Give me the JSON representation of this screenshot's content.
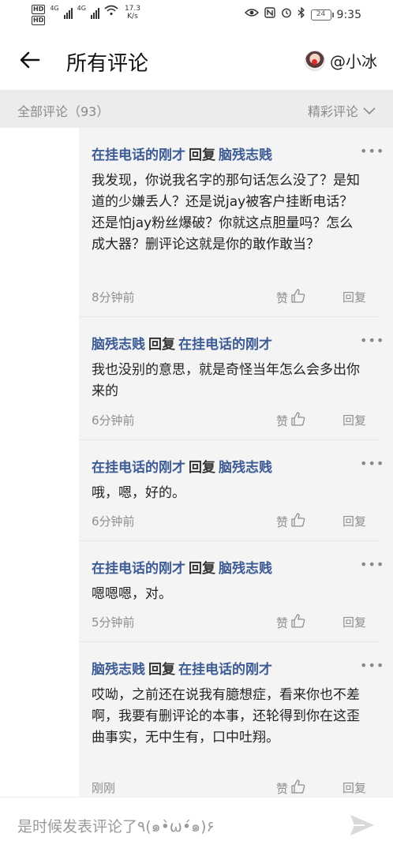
{
  "status_bar": {
    "network_left": "HD",
    "network_right": "HD",
    "signal_type_1": "4G",
    "signal_type_2": "4G",
    "speed_value": "17.3",
    "speed_unit": "K/s",
    "battery": "24",
    "time": "9:35"
  },
  "header": {
    "title": "所有评论",
    "username": "@小冰"
  },
  "filter": {
    "all_label": "全部评论（93）",
    "sort_label": "精彩评论"
  },
  "replies": [
    {
      "author": "在挂电话的刚才",
      "verb": "回复",
      "target": "脑残志贱",
      "body": "我发现，你说我名字的那句话怎么没了？是知道的少嫌丢人？还是说jay被客户挂断电话？还是怕jay粉丝爆破？你就这点胆量吗？怎么成大器？删评论这就是你的敢作敢当？",
      "time": "8分钟前",
      "like_label": "赞",
      "reply_label": "回复"
    },
    {
      "author": "脑残志贱",
      "verb": "回复",
      "target": "在挂电话的刚才",
      "body": "我也没别的意思，就是奇怪当年怎么会多出你来的",
      "time": "6分钟前",
      "like_label": "赞",
      "reply_label": "回复"
    },
    {
      "author": "在挂电话的刚才",
      "verb": "回复",
      "target": "脑残志贱",
      "body": "哦，嗯，好的。",
      "time": "6分钟前",
      "like_label": "赞",
      "reply_label": "回复"
    },
    {
      "author": "在挂电话的刚才",
      "verb": "回复",
      "target": "脑残志贱",
      "body": "嗯嗯嗯，对。",
      "time": "5分钟前",
      "like_label": "赞",
      "reply_label": "回复"
    },
    {
      "author": "脑残志贱",
      "verb": "回复",
      "target": "在挂电话的刚才",
      "body": "哎呦，之前还在说我有臆想症，看来你也不差啊，我要有删评论的本事，还轮得到你在这歪曲事实，无中生有，口中吐翔。",
      "time": "刚刚",
      "like_label": "赞",
      "reply_label": "回复"
    }
  ],
  "composer": {
    "placeholder": "是时候发表评论了٩(๑•̀ω•́๑)۶"
  }
}
